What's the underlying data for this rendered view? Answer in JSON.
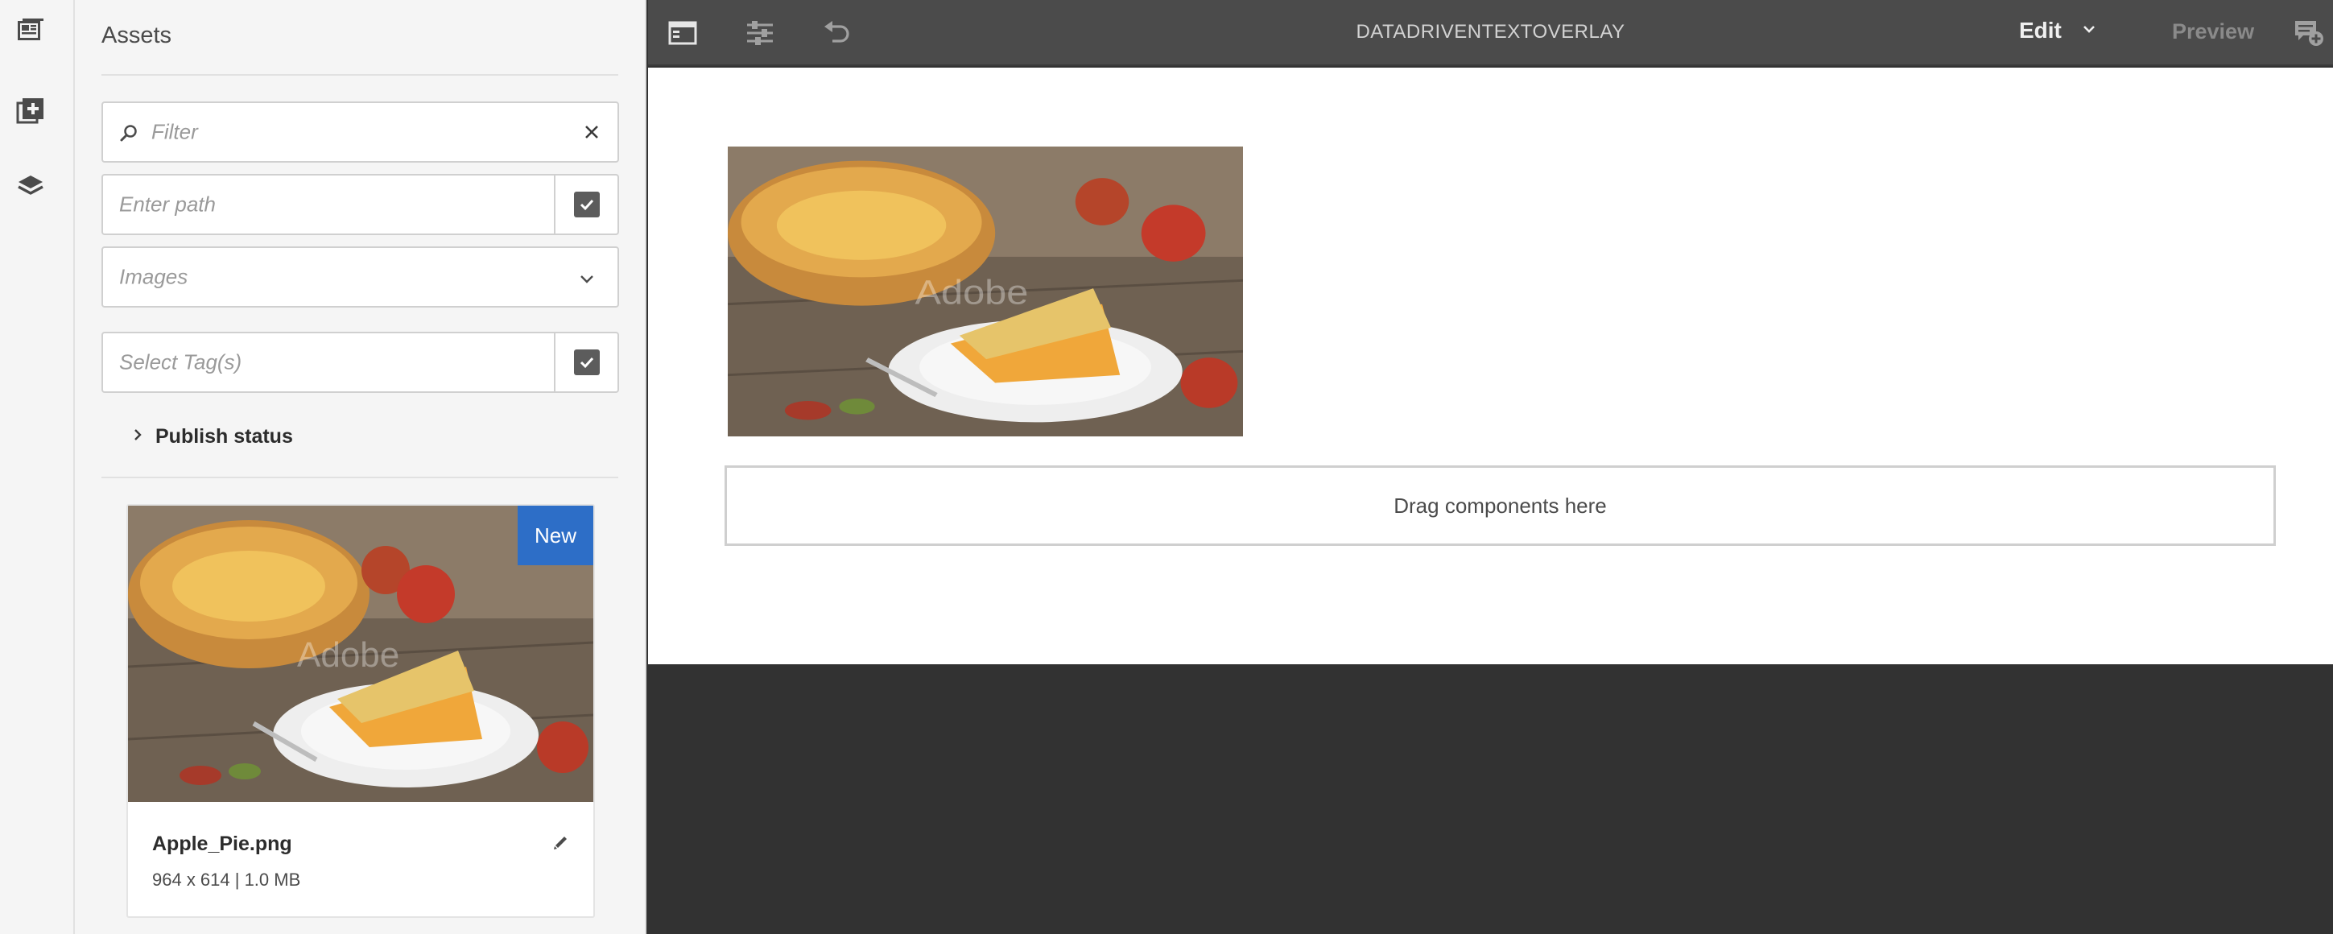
{
  "rail": {
    "items": [
      {
        "icon": "assets-browser-icon"
      },
      {
        "icon": "add-components-icon"
      },
      {
        "icon": "layers-icon"
      }
    ]
  },
  "panel": {
    "title": "Assets",
    "filter": {
      "placeholder": "Filter"
    },
    "path": {
      "placeholder": "Enter path"
    },
    "type_select": {
      "value": "Images"
    },
    "tags": {
      "placeholder": "Select Tag(s)"
    },
    "publish_status": "Publish status",
    "asset": {
      "badge": "New",
      "name": "Apple_Pie.png",
      "meta": "964 x 614 | 1.0 MB"
    }
  },
  "topbar": {
    "title": "DATADRIVENTEXTOVERLAY",
    "mode": "Edit",
    "preview": "Preview"
  },
  "canvas": {
    "dropzone": "Drag components here"
  },
  "colors": {
    "accent": "#2d6ec7",
    "topbar": "#4b4b4b",
    "workspace": "#323232"
  }
}
